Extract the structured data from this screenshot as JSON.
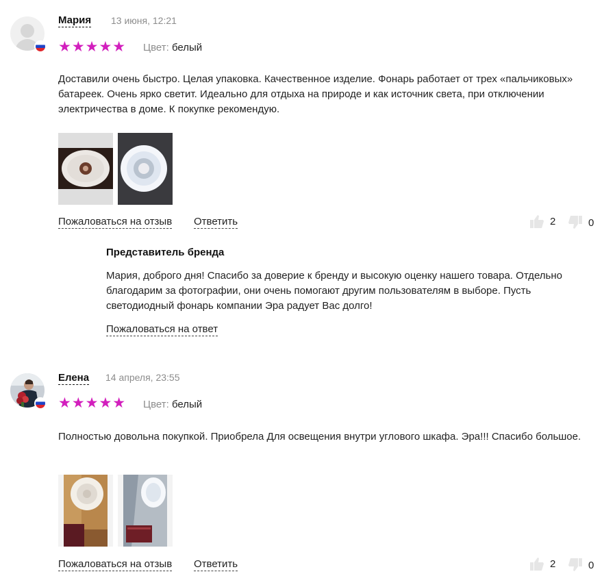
{
  "reviews": [
    {
      "author": "Мария",
      "date": "13 июня, 12:21",
      "stars": "★★★★★",
      "color_label": "Цвет:",
      "color_value": "белый",
      "text": "Доставили очень быстро. Целая упаковка. Качественное изделие. Фонарь работает от трех «пальчиковых» батареек. Очень ярко светит. Идеально для отдыха на природе и как источник света, при отключении электричества в доме. К покупке рекомендую.",
      "complain_label": "Пожаловаться на отзыв",
      "reply_label": "Ответить",
      "likes": "2",
      "dislikes": "0",
      "brand_reply": {
        "title": "Представитель бренда",
        "text": "Мария, доброго дня! Спасибо за доверие к бренду и высокую оценку нашего товара. Отдельно благодарим за фотографии, они очень помогают другим пользователям в выборе. Пусть светодиодный фонарь компании Эра радует Вас долго!",
        "complain_label": "Пожаловаться на ответ"
      }
    },
    {
      "author": "Елена",
      "date": "14 апреля, 23:55",
      "stars": "★★★★★",
      "color_label": "Цвет:",
      "color_value": "белый",
      "text": "Полностью довольна покупкой. Приобрела Для освещения внутри углового шкафа. Эра!!! Спасибо большое.",
      "complain_label": "Пожаловаться на отзыв",
      "reply_label": "Ответить",
      "likes": "2",
      "dislikes": "0"
    }
  ],
  "colors": {
    "star": "#d21fbd",
    "muted": "#8c8c8c",
    "icon": "#e6e6e6"
  },
  "icons": [
    "user-avatar-icon",
    "russia-flag-icon",
    "thumbs-up-icon",
    "thumbs-down-icon"
  ]
}
